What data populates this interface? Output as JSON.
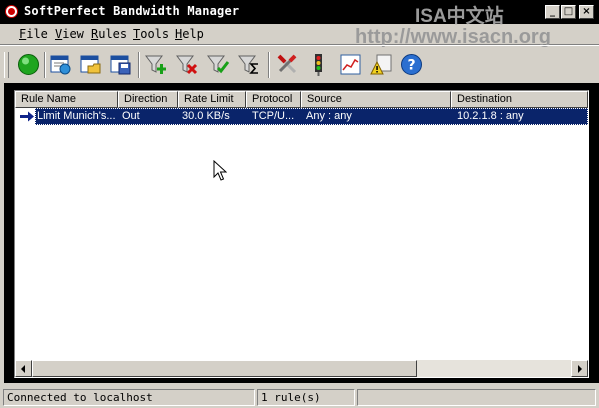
{
  "window": {
    "title": "SoftPerfect Bandwidth Manager",
    "watermark_top": "ISA中文站",
    "watermark_url": "http://www.isacn.org",
    "controls": {
      "minimize": "_",
      "maximize": "□",
      "close": "×"
    }
  },
  "menu": [
    "File",
    "View",
    "Rules",
    "Tools",
    "Help"
  ],
  "toolbar": {
    "buttons": [
      {
        "icon": "green-circle-icon"
      },
      {
        "icon": "window-refresh-icon"
      },
      {
        "icon": "window-folder-icon"
      },
      {
        "icon": "window-save-icon"
      },
      {
        "icon": "filter-add-icon"
      },
      {
        "icon": "filter-delete-icon"
      },
      {
        "icon": "filter-check-icon"
      },
      {
        "icon": "filter-sum-icon"
      },
      {
        "icon": "tools-icon"
      },
      {
        "icon": "traffic-light-icon"
      },
      {
        "icon": "chart-icon"
      },
      {
        "icon": "warning-log-icon"
      },
      {
        "icon": "help-icon"
      }
    ]
  },
  "list": {
    "columns": [
      "Rule Name",
      "Direction",
      "Rate Limit",
      "Protocol",
      "Source",
      "Destination"
    ],
    "rows": [
      {
        "rule_name": "Limit Munich's...",
        "direction": "Out",
        "rate_limit": "30.0 KB/s",
        "protocol": "TCP/U...",
        "source": "Any : any",
        "destination": "10.2.1.8 : any",
        "selected": true
      }
    ]
  },
  "status": {
    "connection": "Connected to localhost",
    "rules": "1 rule(s)",
    "extra": ""
  },
  "colors": {
    "titlebar": "#000000",
    "selection": "#0a246a",
    "face": "#d4d0c8"
  }
}
